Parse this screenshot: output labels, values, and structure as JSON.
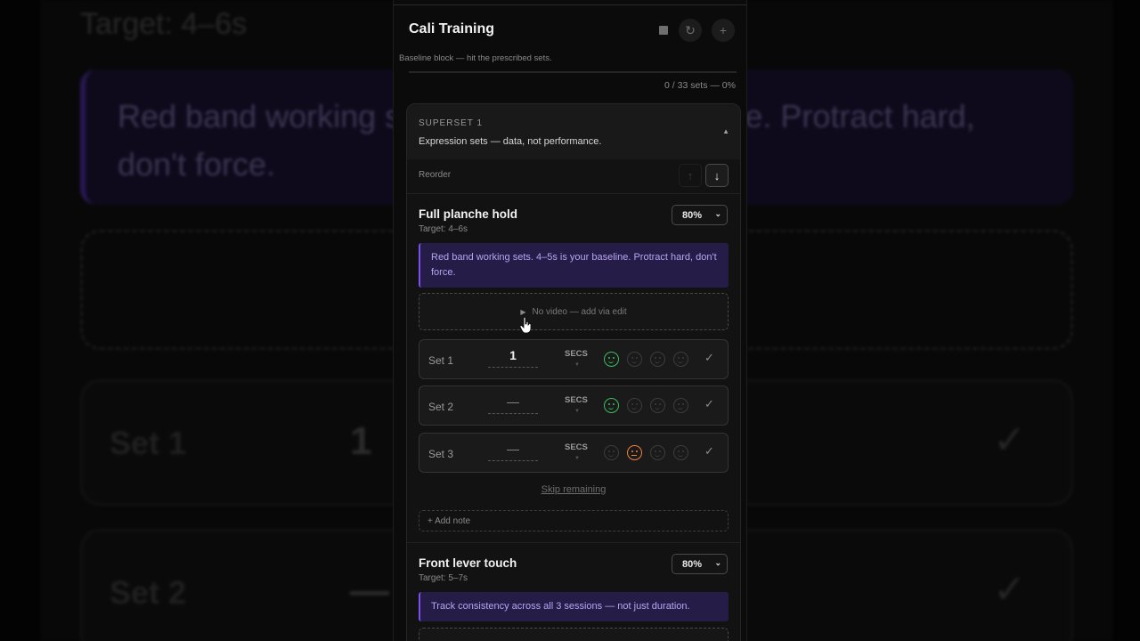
{
  "app": {
    "title": "Cali Training",
    "subtitle": "Baseline block — hit the prescribed sets.",
    "progress_text": "0 / 33 sets — 0%",
    "progress_fraction": 0,
    "header_icons": [
      "stop-icon",
      "reset-icon",
      "add-icon"
    ]
  },
  "superset": {
    "label": "SUPERSET 1",
    "description": "Expression sets — data, not performance.",
    "caret": "▲",
    "reorder_label": "Reorder",
    "up_arrow": "↑",
    "down_arrow": "↓"
  },
  "exercises": [
    {
      "name": "Full planche hold",
      "target": "Target: 4–6s",
      "intensity": "80%",
      "note": "Red band working sets. 4–5s is your baseline. Protract hard, don't force.",
      "video_text": "No video — add via edit",
      "sets": [
        {
          "label": "Set 1",
          "value": "1",
          "unit": "SECS",
          "selected_face": 0,
          "face_color": "#3dbd5c"
        },
        {
          "label": "Set 2",
          "value": "—",
          "unit": "SECS",
          "selected_face": 0,
          "face_color": "#3dbd5c"
        },
        {
          "label": "Set 3",
          "value": "—",
          "unit": "SECS",
          "selected_face": 1,
          "face_color": "#f0813a"
        }
      ],
      "skip_label": "Skip remaining",
      "add_note_label": "+ Add note"
    },
    {
      "name": "Front lever touch",
      "target": "Target: 5–7s",
      "intensity": "80%",
      "note": "Track consistency across all 3 sessions — not just duration."
    }
  ],
  "colors": {
    "accent_purple": "#7a4ff0",
    "face_good": "#3dbd5c",
    "face_ok": "#f0813a"
  }
}
